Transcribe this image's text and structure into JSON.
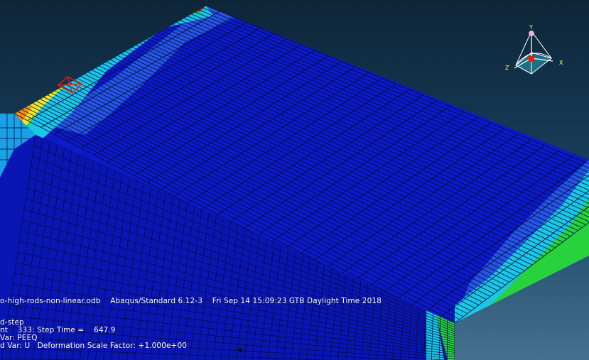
{
  "viewport": {
    "odb_line": "o-high-rods-non-linear.odb    Abaqus/Standard 6.12-3    Fri Sep 14 15:09:23 GTB Daylight Time 2018",
    "step_line": "d-step",
    "increment_line": "nt    333: Step Time =    647.9",
    "primary_var_line": "Var: PEEQ",
    "deformed_var_line": "d Var: U   Deformation Scale Factor: +1.000e+00"
  },
  "triad": {
    "y_label": "Y",
    "z_label": "Z",
    "x_label": "X"
  },
  "colors": {
    "mesh_base": "#0c1ac8",
    "mesh_lines": "#05083a",
    "contour_cyan": "#19c8e6",
    "contour_green": "#28d23c",
    "contour_yellow": "#f0e628",
    "contour_orange": "#f58c14",
    "contour_red": "#e61e0a"
  }
}
